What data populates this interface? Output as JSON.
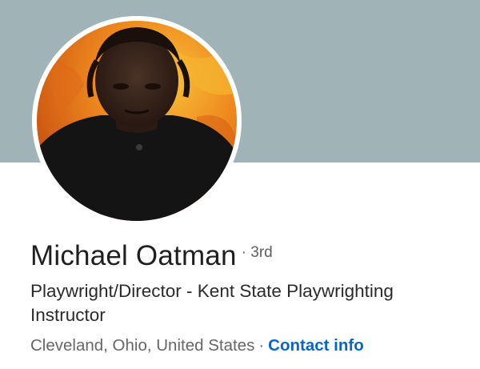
{
  "profile": {
    "name": "Michael Oatman",
    "degree": "· 3rd",
    "headline": "Playwright/Director - Kent State Playwrighting Instructor",
    "location": "Cleveland, Ohio, United States",
    "separator": "·",
    "contact_link": "Contact info"
  },
  "colors": {
    "cover": "#a0b4b7",
    "link": "#0a66c2",
    "name_text": "#1f1f1f",
    "muted_text": "#666666"
  }
}
